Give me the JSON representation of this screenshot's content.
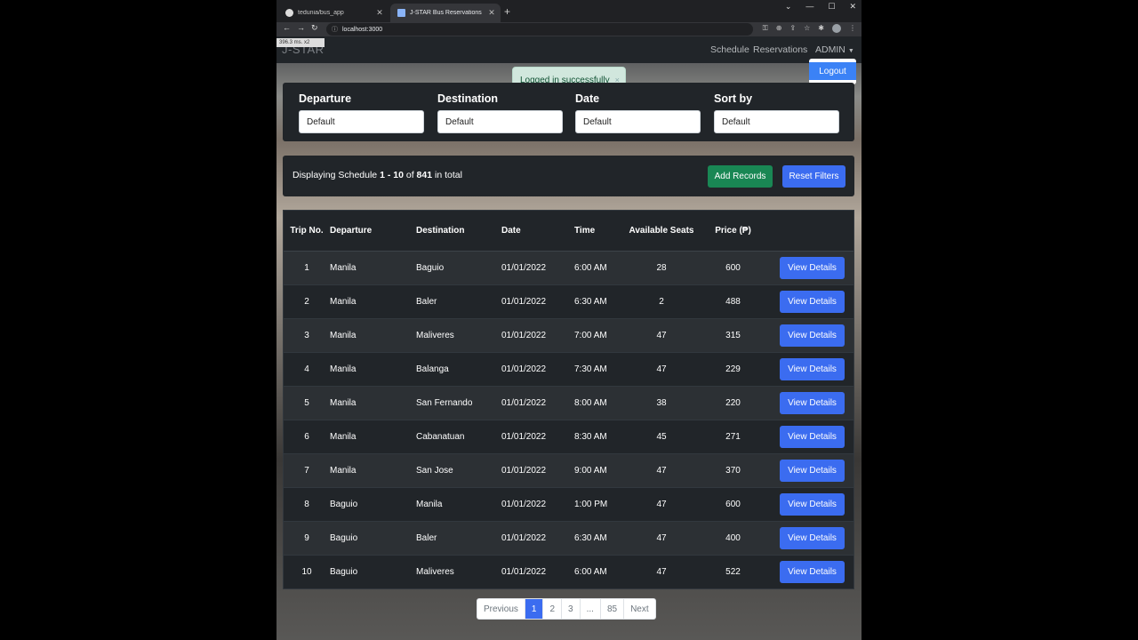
{
  "browser": {
    "tabs": [
      {
        "title": "tedunia/bus_app"
      },
      {
        "title": "J-STAR Bus Reservations"
      }
    ],
    "new_tab": "+",
    "url": "localhost:3000",
    "perf_overlay": "396.3 ms. x2"
  },
  "navbar": {
    "brand": "J-STAR",
    "links": [
      "Schedule",
      "Reservations"
    ],
    "user_menu": "ADMIN",
    "logout": "Logout"
  },
  "toast": {
    "message": "Logged in successfully",
    "close": "×"
  },
  "filters": [
    {
      "label": "Departure",
      "value": "Default"
    },
    {
      "label": "Destination",
      "value": "Default"
    },
    {
      "label": "Date",
      "value": "Default"
    },
    {
      "label": "Sort by",
      "value": "Default"
    }
  ],
  "summary": {
    "prefix": "Displaying Schedule",
    "range": "1 - 10",
    "of": "of",
    "total": "841",
    "suffix": "in total",
    "add_button": "Add Records",
    "reset_button": "Reset Filters"
  },
  "table": {
    "headers": [
      "Trip No.",
      "Departure",
      "Destination",
      "Date",
      "Time",
      "Available Seats",
      "Price (₱)",
      ""
    ],
    "action_label": "View Details",
    "rows": [
      {
        "trip": "1",
        "dep": "Manila",
        "dest": "Baguio",
        "date": "01/01/2022",
        "time": "6:00 AM",
        "seats": "28",
        "price": "600"
      },
      {
        "trip": "2",
        "dep": "Manila",
        "dest": "Baler",
        "date": "01/01/2022",
        "time": "6:30 AM",
        "seats": "2",
        "price": "488"
      },
      {
        "trip": "3",
        "dep": "Manila",
        "dest": "Maliveres",
        "date": "01/01/2022",
        "time": "7:00 AM",
        "seats": "47",
        "price": "315"
      },
      {
        "trip": "4",
        "dep": "Manila",
        "dest": "Balanga",
        "date": "01/01/2022",
        "time": "7:30 AM",
        "seats": "47",
        "price": "229"
      },
      {
        "trip": "5",
        "dep": "Manila",
        "dest": "San Fernando",
        "date": "01/01/2022",
        "time": "8:00 AM",
        "seats": "38",
        "price": "220"
      },
      {
        "trip": "6",
        "dep": "Manila",
        "dest": "Cabanatuan",
        "date": "01/01/2022",
        "time": "8:30 AM",
        "seats": "45",
        "price": "271"
      },
      {
        "trip": "7",
        "dep": "Manila",
        "dest": "San Jose",
        "date": "01/01/2022",
        "time": "9:00 AM",
        "seats": "47",
        "price": "370"
      },
      {
        "trip": "8",
        "dep": "Baguio",
        "dest": "Manila",
        "date": "01/01/2022",
        "time": "1:00 PM",
        "seats": "47",
        "price": "600"
      },
      {
        "trip": "9",
        "dep": "Baguio",
        "dest": "Baler",
        "date": "01/01/2022",
        "time": "6:30 AM",
        "seats": "47",
        "price": "400"
      },
      {
        "trip": "10",
        "dep": "Baguio",
        "dest": "Maliveres",
        "date": "01/01/2022",
        "time": "6:00 AM",
        "seats": "47",
        "price": "522"
      }
    ]
  },
  "pagination": {
    "items": [
      "Previous",
      "1",
      "2",
      "3",
      "...",
      "85",
      "Next"
    ],
    "active": "1"
  },
  "colors": {
    "primary": "#3b6cf0",
    "success": "#198754",
    "dark": "#212529"
  }
}
